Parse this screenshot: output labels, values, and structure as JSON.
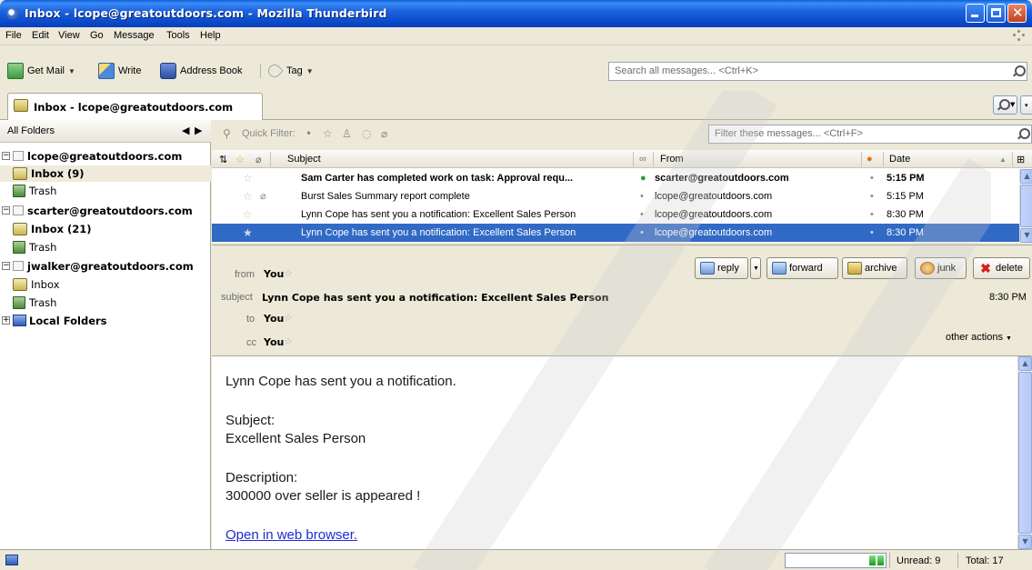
{
  "window": {
    "title": "Inbox - lcope@greatoutdoors.com - Mozilla Thunderbird"
  },
  "menu": [
    "File",
    "Edit",
    "View",
    "Go",
    "Message",
    "Tools",
    "Help"
  ],
  "toolbar": {
    "get_mail": "Get Mail",
    "write": "Write",
    "address_book": "Address Book",
    "tag": "Tag",
    "search_placeholder": "Search all messages... <Ctrl+K>"
  },
  "tab": {
    "label": "Inbox - lcope@greatoutdoors.com"
  },
  "folder_pane": {
    "header": "All Folders",
    "accounts": [
      {
        "name": "lcope@greatoutdoors.com",
        "folders": [
          {
            "label": "Inbox (9)",
            "bold": true,
            "selected": true
          },
          {
            "label": "Trash"
          }
        ]
      },
      {
        "name": "scarter@greatoutdoors.com",
        "folders": [
          {
            "label": "Inbox (21)",
            "bold": true
          },
          {
            "label": "Trash"
          }
        ]
      },
      {
        "name": "jwalker@greatoutdoors.com",
        "folders": [
          {
            "label": "Inbox"
          },
          {
            "label": "Trash"
          }
        ]
      }
    ],
    "local_folders": "Local Folders"
  },
  "quick_filter": {
    "label": "Quick Filter:",
    "filter_placeholder": "Filter these messages... <Ctrl+F>"
  },
  "columns": {
    "subject": "Subject",
    "from": "From",
    "date": "Date"
  },
  "messages": [
    {
      "subject": "Sam Carter has completed work on task: Approval requ...",
      "from": "scarter@greatoutdoors.com",
      "date": "5:15 PM",
      "unread": true,
      "attachment": false,
      "selected": false
    },
    {
      "subject": "Burst Sales Summary report complete",
      "from": "lcope@greatoutdoors.com",
      "date": "5:15 PM",
      "unread": false,
      "attachment": true,
      "selected": false
    },
    {
      "subject": "Lynn Cope has sent you a notification: Excellent Sales Person",
      "from": "lcope@greatoutdoors.com",
      "date": "8:30 PM",
      "unread": false,
      "attachment": false,
      "selected": false
    },
    {
      "subject": "Lynn Cope has sent you a notification: Excellent Sales Person",
      "from": "lcope@greatoutdoors.com",
      "date": "8:30 PM",
      "unread": false,
      "attachment": false,
      "selected": true
    }
  ],
  "header": {
    "from_label": "from",
    "from_value": "You",
    "subject_label": "subject",
    "subject_value": "Lynn Cope has sent you a notification: Excellent Sales Person",
    "to_label": "to",
    "to_value": "You",
    "cc_label": "cc",
    "cc_value": "You",
    "date": "8:30 PM",
    "other_actions": "other actions",
    "buttons": {
      "reply": "reply",
      "forward": "forward",
      "archive": "archive",
      "junk": "junk",
      "delete": "delete"
    }
  },
  "body": {
    "line1": "Lynn Cope has sent you a notification.",
    "subject_label": "Subject:",
    "subject_value": "Excellent Sales Person",
    "description_label": "Description:",
    "description_value": "300000 over seller is appeared !",
    "link": "Open in web browser."
  },
  "status": {
    "unread": "Unread: 9",
    "total": "Total: 17"
  },
  "colors": {
    "selection": "#316ac5",
    "titlebar": "#0a5fdc",
    "link": "#1f2bd6"
  }
}
